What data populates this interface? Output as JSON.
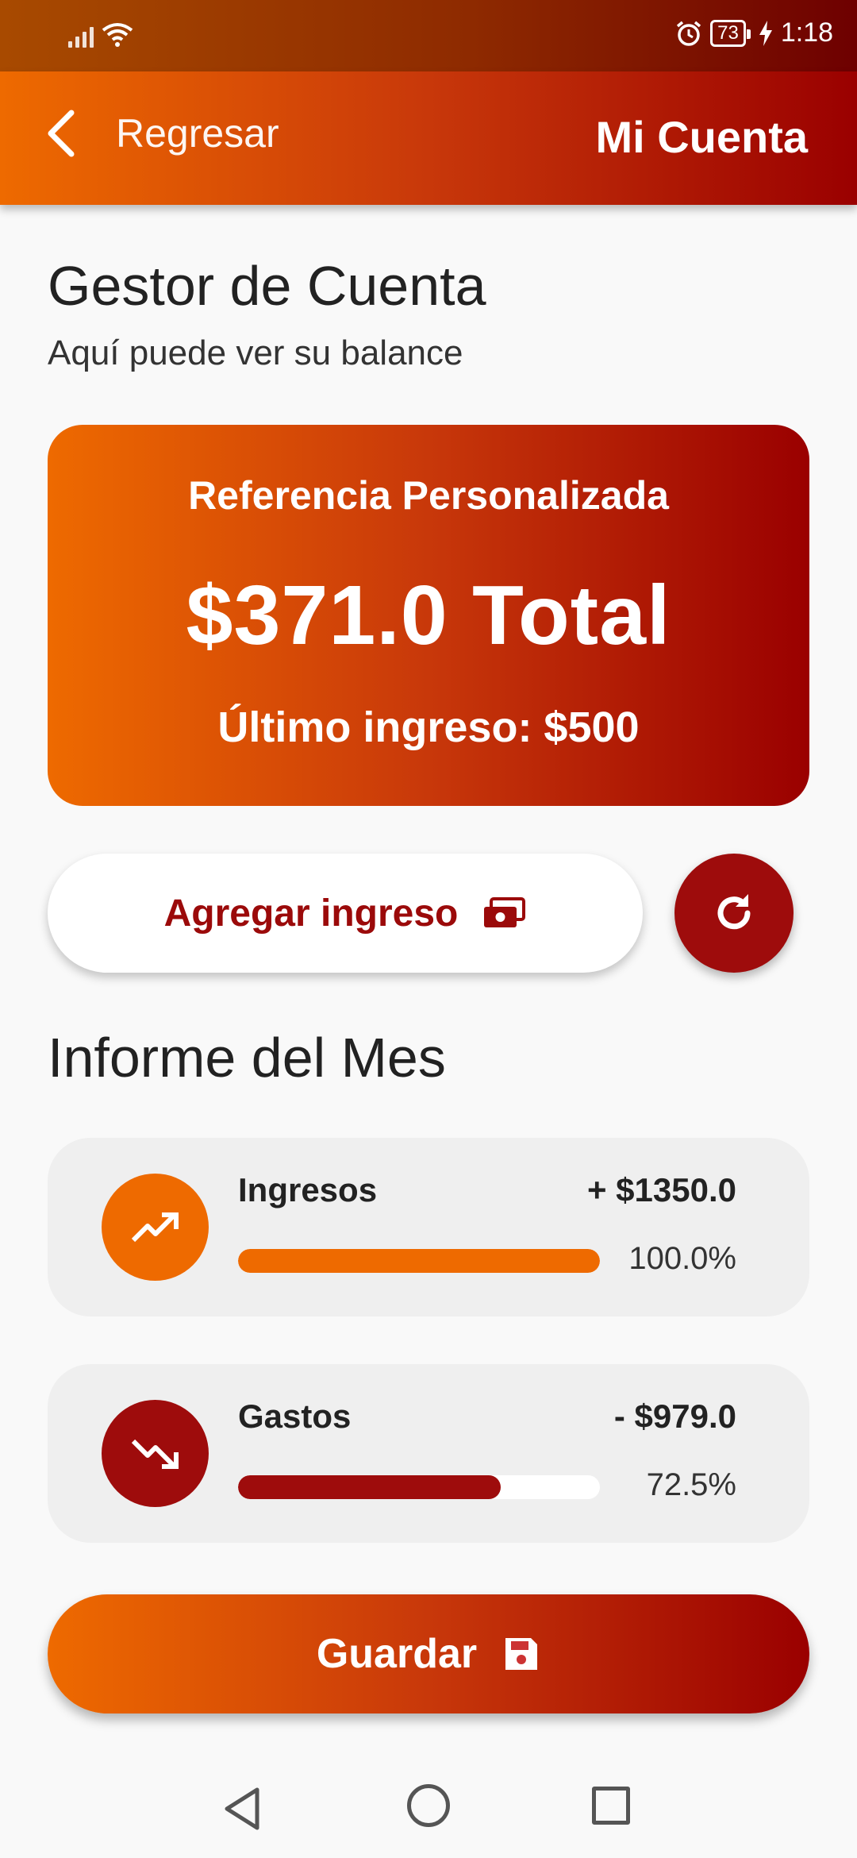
{
  "status_bar": {
    "time": "1:18",
    "battery": "73",
    "icons": [
      "signal-icon",
      "wifi-icon",
      "alarm-icon",
      "battery-icon",
      "charging-icon"
    ]
  },
  "app_bar": {
    "back_label": "Regresar",
    "title": "Mi Cuenta"
  },
  "header": {
    "title": "Gestor de Cuenta",
    "subtitle": "Aquí puede ver su balance"
  },
  "balance_card": {
    "reference": "Referencia Personalizada",
    "total": "$371.0 Total",
    "last_income": "Último ingreso: $500"
  },
  "actions": {
    "add_income_label": "Agregar ingreso",
    "add_income_icon": "money-icon",
    "refresh_icon": "refresh-icon"
  },
  "report": {
    "title": "Informe del Mes",
    "items": [
      {
        "label": "Ingresos",
        "amount": "+ $1350.0",
        "percent_label": "100.0%",
        "percent": 100.0,
        "icon": "trending-up-icon",
        "color": "#ee6a00"
      },
      {
        "label": "Gastos",
        "amount": "- $979.0",
        "percent_label": "72.5%",
        "percent": 72.5,
        "icon": "trending-down-icon",
        "color": "#9e0c0c"
      }
    ]
  },
  "save": {
    "label": "Guardar",
    "icon": "save-icon"
  },
  "colors": {
    "accent_orange": "#ee6a00",
    "accent_red": "#9a0000",
    "card_bg": "#efefef"
  }
}
